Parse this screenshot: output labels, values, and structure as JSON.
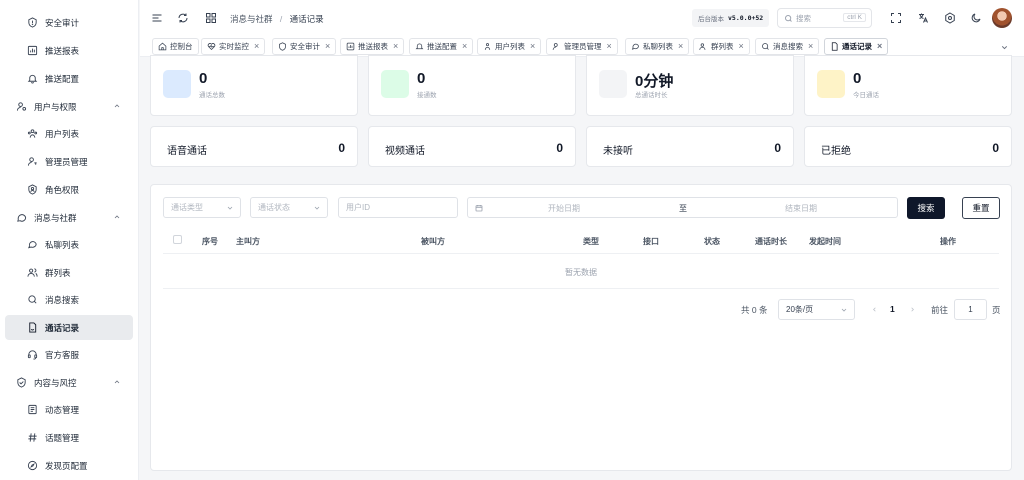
{
  "sidebar": {
    "items": [
      {
        "label": "安全审计",
        "icon": "shield-icon"
      },
      {
        "label": "推送报表",
        "icon": "bar-chart-icon"
      },
      {
        "label": "推送配置",
        "icon": "bell-icon"
      },
      {
        "label": "用户与权限",
        "icon": "user-cog-icon"
      },
      {
        "label": "用户列表",
        "icon": "users-icon"
      },
      {
        "label": "管理员管理",
        "icon": "user-key-icon"
      },
      {
        "label": "角色权限",
        "icon": "shield-user-icon"
      },
      {
        "label": "消息与社群",
        "icon": "chat-icon"
      },
      {
        "label": "私聊列表",
        "icon": "chat-bubble-icon"
      },
      {
        "label": "群列表",
        "icon": "group-icon"
      },
      {
        "label": "消息搜索",
        "icon": "search-icon"
      },
      {
        "label": "通话记录",
        "icon": "call-record-icon"
      },
      {
        "label": "官方客服",
        "icon": "headset-icon"
      },
      {
        "label": "内容与风控",
        "icon": "shield-check-icon"
      },
      {
        "label": "动态管理",
        "icon": "document-icon"
      },
      {
        "label": "话题管理",
        "icon": "hash-icon"
      },
      {
        "label": "发现页配置",
        "icon": "compass-icon"
      }
    ]
  },
  "header": {
    "breadcrumb_parent": "消息与社群",
    "breadcrumb_sep": "/",
    "breadcrumb_current": "通话记录",
    "version_label": "后台版本",
    "version_value": "v5.0.0+52",
    "search_placeholder": "搜索",
    "search_shortcut": "ctrl K"
  },
  "tabs": [
    {
      "label": "控制台",
      "icon": "home-icon",
      "closable": false
    },
    {
      "label": "实时监控",
      "icon": "heart-pulse-icon",
      "closable": true
    },
    {
      "label": "安全审计",
      "icon": "shield-icon",
      "closable": true
    },
    {
      "label": "推送报表",
      "icon": "bar-chart-icon",
      "closable": true
    },
    {
      "label": "推送配置",
      "icon": "bell-icon",
      "closable": true
    },
    {
      "label": "用户列表",
      "icon": "users-icon",
      "closable": true
    },
    {
      "label": "管理员管理",
      "icon": "user-key-icon",
      "closable": true
    },
    {
      "label": "私聊列表",
      "icon": "chat-bubble-icon",
      "closable": true
    },
    {
      "label": "群列表",
      "icon": "group-icon",
      "closable": true
    },
    {
      "label": "消息搜索",
      "icon": "search-icon",
      "closable": true
    },
    {
      "label": "通话记录",
      "icon": "call-record-icon",
      "closable": true,
      "active": true
    }
  ],
  "stats": [
    {
      "value": "0",
      "label": "通话总数",
      "color": "#dbeafe"
    },
    {
      "value": "0",
      "label": "接通数",
      "color": "#dcfce7"
    },
    {
      "value": "0分钟",
      "label": "总通话时长",
      "color": "#f3f4f6"
    },
    {
      "value": "0",
      "label": "今日通话",
      "color": "#fef3c7"
    }
  ],
  "summary": [
    {
      "label": "语音通话",
      "value": "0"
    },
    {
      "label": "视频通话",
      "value": "0"
    },
    {
      "label": "未接听",
      "value": "0"
    },
    {
      "label": "已拒绝",
      "value": "0"
    }
  ],
  "filters": {
    "call_type_placeholder": "通话类型",
    "call_status_placeholder": "通话状态",
    "user_id_placeholder": "用户ID",
    "start_date_placeholder": "开始日期",
    "date_sep": "至",
    "end_date_placeholder": "结束日期",
    "search_label": "搜索",
    "reset_label": "重置"
  },
  "table": {
    "columns": [
      "序号",
      "主叫方",
      "被叫方",
      "类型",
      "接口",
      "状态",
      "通话时长",
      "发起时间",
      "操作"
    ],
    "empty_text": "暂无数据"
  },
  "pagination": {
    "total_text": "共 0 条",
    "page_size": "20条/页",
    "current_page": "1",
    "goto_label": "前往",
    "goto_value": "1",
    "page_suffix": "页"
  },
  "colors": {
    "primary": "#0f172a",
    "accent": "#111827"
  }
}
